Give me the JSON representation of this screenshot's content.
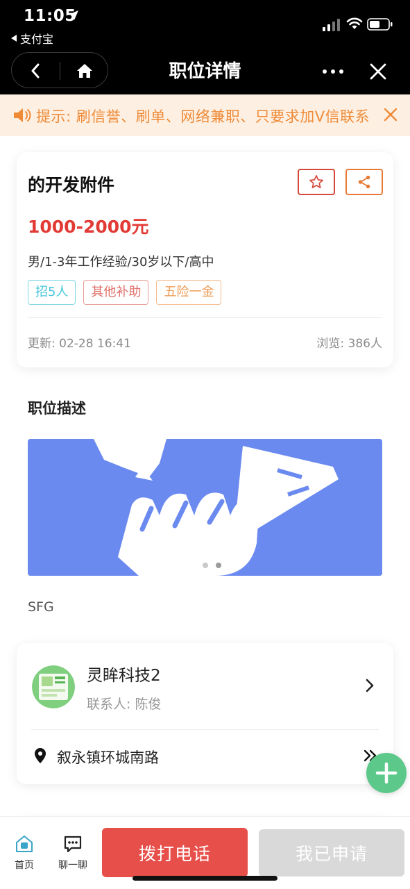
{
  "status_bar": {
    "time": "11:05",
    "back_app_label": "支付宝"
  },
  "nav": {
    "title": "职位详情"
  },
  "notice": {
    "text": "提示: 刷信誉、刷单、网络兼职、只要求加V信联系"
  },
  "job": {
    "title": "的开发附件",
    "salary": "1000-2000元",
    "requirements": "男/1-3年工作经验/30岁以下/高中",
    "tags": [
      "招5人",
      "其他补助",
      "五险一金"
    ],
    "update_time": "更新: 02-28 16:41",
    "views": "浏览: 386人"
  },
  "description": {
    "heading": "职位描述",
    "text": "SFG"
  },
  "company": {
    "name": "灵眸科技2",
    "contact": "联系人: 陈俊",
    "address": "叙永镇环城南路"
  },
  "bottom_bar": {
    "home_label": "首页",
    "chat_label": "聊一聊",
    "call_label": "拨打电话",
    "applied_label": "我已申请"
  },
  "colors": {
    "accent_red": "#e74f4a",
    "salary_red": "#e23b36",
    "notice_orange": "#ef8a37",
    "banner_blue": "#6b8af0",
    "fab_green": "#5cc98a"
  }
}
